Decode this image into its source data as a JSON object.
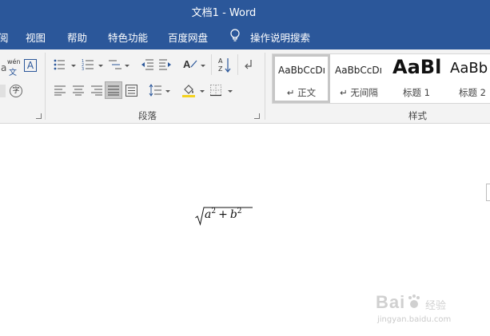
{
  "window": {
    "title": "文档1  -  Word"
  },
  "menu": {
    "items": [
      "阅",
      "视图",
      "帮助",
      "特色功能",
      "百度网盘"
    ],
    "search_label": "操作说明搜索"
  },
  "ribbon": {
    "font_group": {
      "phonetic_top": "wén",
      "phonetic_bottom": "文",
      "border_char": "A",
      "enclose_char": "字"
    },
    "paragraph_group": {
      "label": "段落"
    },
    "styles_group": {
      "label": "样式",
      "items": [
        {
          "sample": "AaBbCcDı",
          "name": "↵ 正文"
        },
        {
          "sample": "AaBbCcDı",
          "name": "↵ 无间隔"
        },
        {
          "sample": "AaBl",
          "name": "标题 1"
        },
        {
          "sample": "AaBb",
          "name": "标题 2"
        }
      ]
    }
  },
  "document": {
    "formula": {
      "base_a": "a",
      "exp_a": "2",
      "operator": "+",
      "base_b": "b",
      "exp_b": "2"
    }
  },
  "watermark": {
    "logo": "Bai",
    "sub": "经验",
    "url": "jingyan.baidu.com"
  }
}
